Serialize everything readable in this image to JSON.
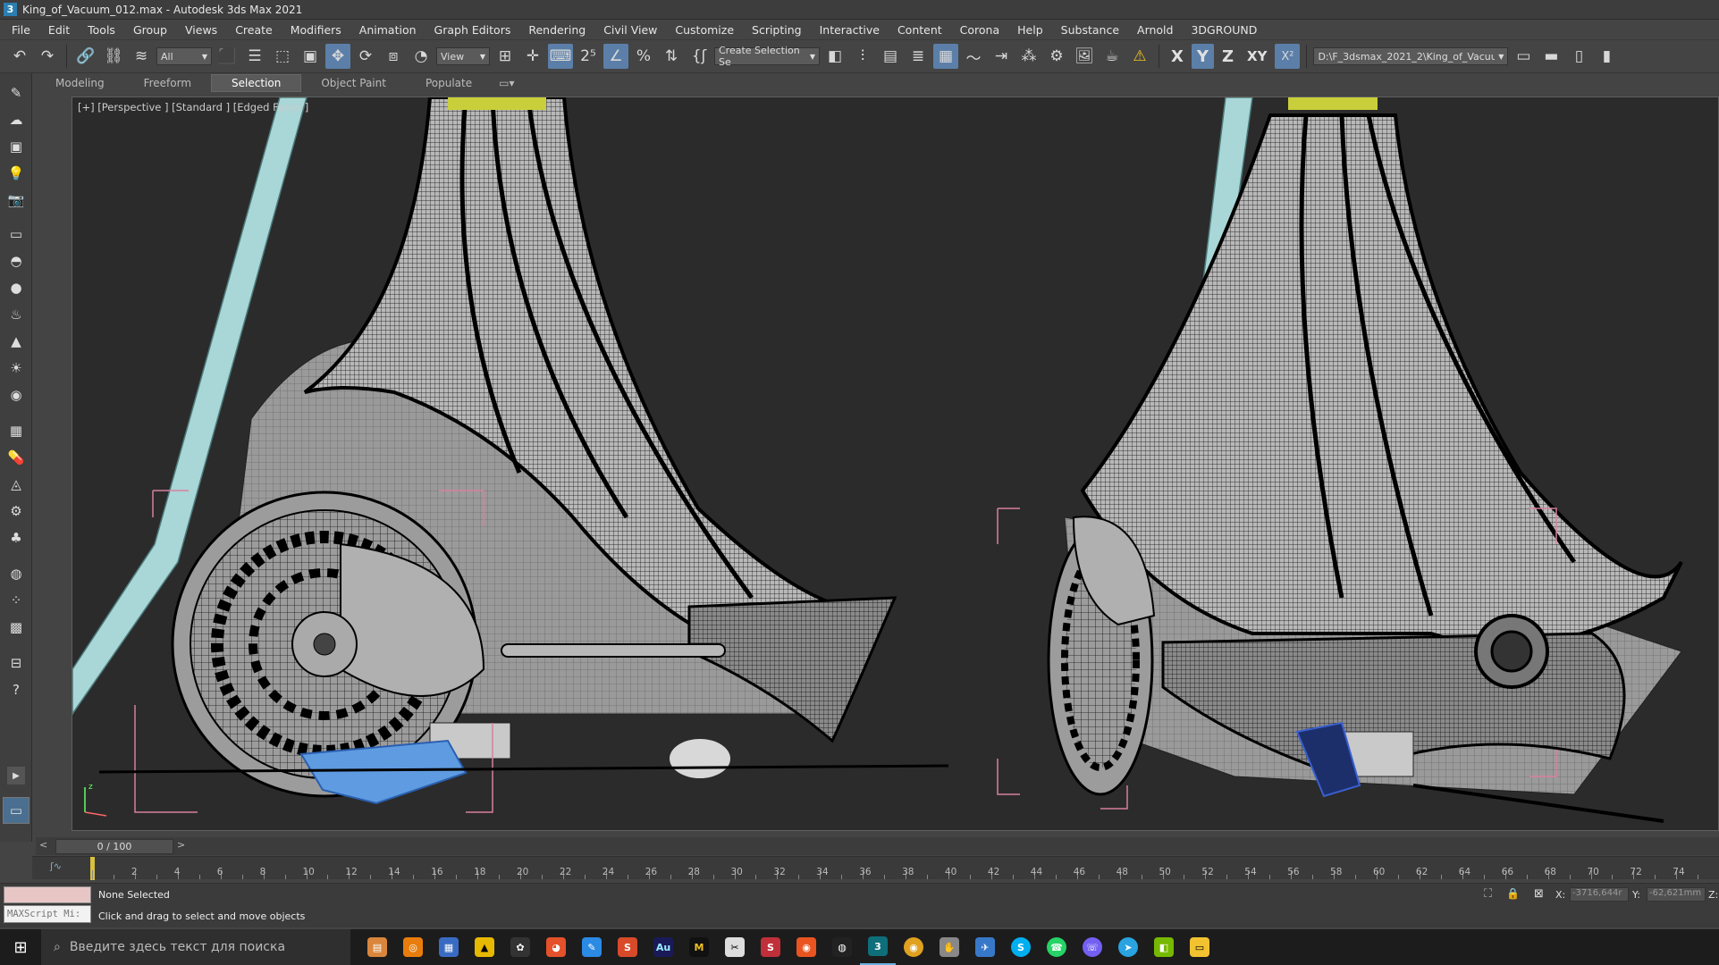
{
  "window": {
    "title": "King_of_Vacuum_012.max - Autodesk 3ds Max 2021",
    "app_icon": "3"
  },
  "menu": [
    "File",
    "Edit",
    "Tools",
    "Group",
    "Views",
    "Create",
    "Modifiers",
    "Animation",
    "Graph Editors",
    "Rendering",
    "Civil View",
    "Customize",
    "Scripting",
    "Interactive",
    "Content",
    "Corona",
    "Help",
    "Substance",
    "Arnold",
    "3DGROUND"
  ],
  "toolbar": {
    "filter_value": "All",
    "refcoord_value": "View",
    "selection_set_value": "Create Selection Se",
    "axes": [
      "X",
      "Y",
      "Z",
      "XY"
    ],
    "active_axis": "Y",
    "project_path": "D:\\F_3dsmax_2021_2\\King_of_Vacuum"
  },
  "ribbon": {
    "tabs": [
      "Modeling",
      "Freeform",
      "Selection",
      "Object Paint",
      "Populate"
    ],
    "active": "Selection"
  },
  "viewport": {
    "label": "[+] [Perspective ] [Standard ] [Edged Faces ]"
  },
  "timeline": {
    "slider_label": "0 / 100",
    "ticks": [
      "2",
      "4",
      "6",
      "8",
      "10",
      "12",
      "14",
      "16",
      "18",
      "20",
      "22",
      "24",
      "26",
      "28",
      "30",
      "32",
      "34",
      "36",
      "38",
      "40",
      "42",
      "44",
      "46",
      "48",
      "50",
      "52",
      "54",
      "56",
      "58",
      "60",
      "62",
      "64",
      "66",
      "68",
      "70",
      "72",
      "74"
    ]
  },
  "status": {
    "selection": "None Selected",
    "prompt": "Click and drag to select and move objects",
    "maxscript_placeholder": "MAXScript Mi:",
    "x_label": "X:",
    "x_value": "-3716,644r",
    "y_label": "Y:",
    "y_value": "-62,621mm",
    "z_label": "Z:"
  },
  "taskbar": {
    "search_placeholder": "Введите здесь текст для поиска"
  },
  "colors": {
    "accent": "#5b7fa8",
    "viewport_bg": "#2b2b2b",
    "ui_bg": "#444444",
    "taskbar": "#1c1c1c"
  }
}
